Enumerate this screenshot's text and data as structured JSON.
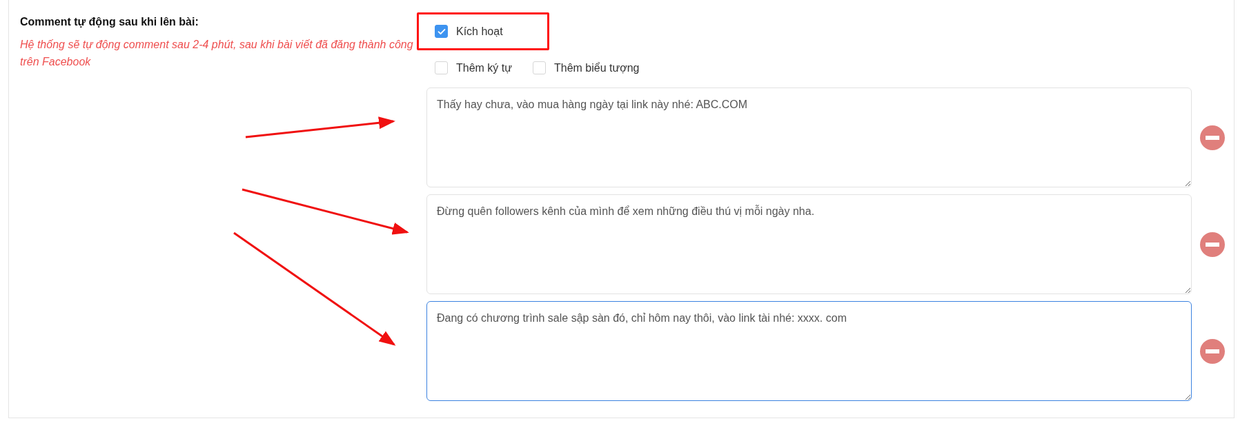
{
  "section": {
    "title": "Comment tự động sau khi lên bài:",
    "note": "Hệ thống sẽ tự động comment sau 2-4 phút, sau khi bài viết đã đăng thành công trên Facebook"
  },
  "activate": {
    "label": "Kích hoạt",
    "checked": true
  },
  "options": [
    {
      "label": "Thêm ký tự",
      "checked": false
    },
    {
      "label": "Thêm biểu tượng",
      "checked": false
    }
  ],
  "comments": [
    {
      "value": "Thấy hay chưa, vào mua hàng ngày tại link này nhé: ABC.COM",
      "focused": false
    },
    {
      "value": "Đừng quên followers kênh của mình để xem những điều thú vị mỗi ngày nha.",
      "focused": false
    },
    {
      "value": "Đang có chương trình sale sập sàn đó, chỉ hôm nay thôi, vào link tài nhé: xxxx. com",
      "focused": true
    }
  ]
}
